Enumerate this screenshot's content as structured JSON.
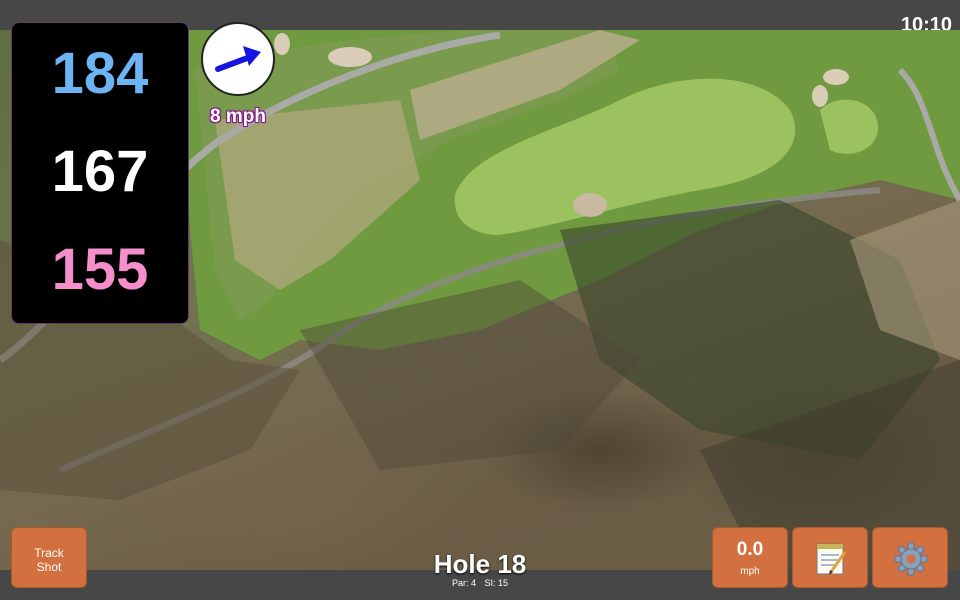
{
  "status_bar": {
    "time": "10:10"
  },
  "yardages": {
    "back": "184",
    "middle": "167",
    "front": "155"
  },
  "wind": {
    "speed": "8 mph",
    "icon": "arrow-right-icon"
  },
  "hole": {
    "title": "Hole 18",
    "par": "Par: 4",
    "stroke_index": "SI: 15"
  },
  "buttons": {
    "track_shot_line1": "Track",
    "track_shot_line2": "Shot",
    "speed_value": "0.0",
    "speed_unit": "mph",
    "notes_icon": "notepad-icon",
    "settings_icon": "gear-icon"
  },
  "colors": {
    "back_yardage": "#6cb4f4",
    "middle_yardage": "#ffffff",
    "front_yardage": "#f58fcb",
    "button_orange": "#d2703f",
    "wind_arrow": "#1515e0"
  }
}
